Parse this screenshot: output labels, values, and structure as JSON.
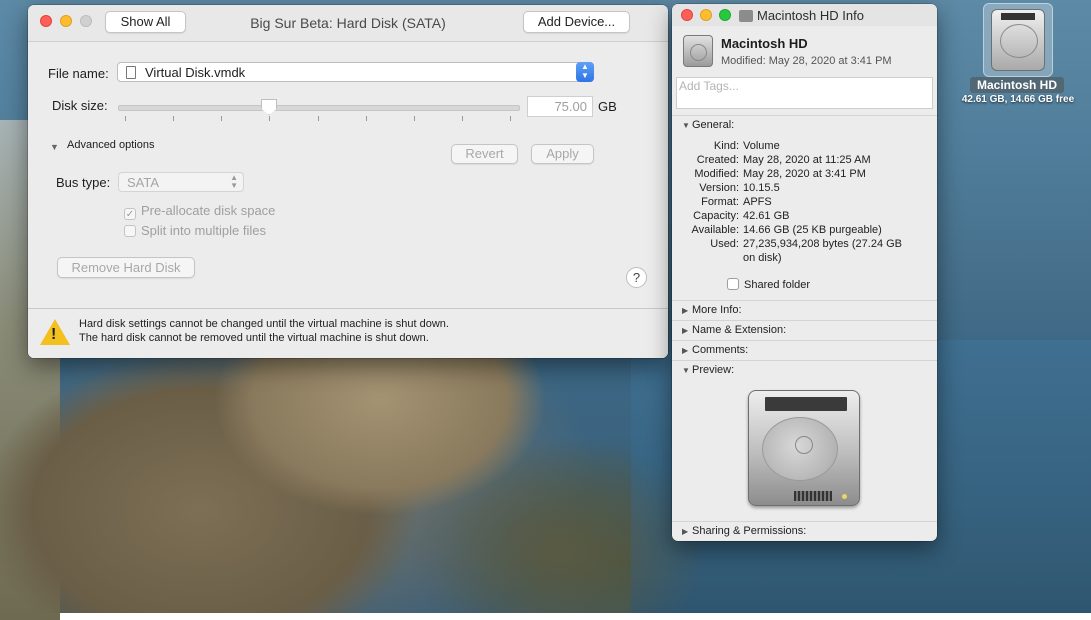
{
  "vm_window": {
    "title": "Big Sur Beta: Hard Disk (SATA)",
    "show_all": "Show All",
    "add_device": "Add Device...",
    "file_name_label": "File name:",
    "file_name": "Virtual Disk.vmdk",
    "disk_size_label": "Disk size:",
    "disk_size_value": "75.00",
    "disk_size_unit": "GB",
    "advanced_options": "Advanced options",
    "revert": "Revert",
    "apply": "Apply",
    "bus_type_label": "Bus type:",
    "bus_type_value": "SATA",
    "preallocate": "Pre-allocate disk space",
    "preallocate_checked": true,
    "split_files": "Split into multiple files",
    "remove_hard_disk": "Remove Hard Disk",
    "help": "?",
    "warning_line1": "Hard disk settings cannot be changed until the virtual machine is shut down.",
    "warning_line2": "The hard disk cannot be removed until the virtual machine is shut down."
  },
  "info_window": {
    "title": "Macintosh HD Info",
    "name": "Macintosh HD",
    "modified_header": "Modified: May 28, 2020 at 3:41 PM",
    "tags_placeholder": "Add Tags...",
    "general_label": "General:",
    "general": [
      {
        "key": "Kind:",
        "value": "Volume"
      },
      {
        "key": "Created:",
        "value": "May 28, 2020 at 11:25 AM"
      },
      {
        "key": "Modified:",
        "value": "May 28, 2020 at 3:41 PM"
      },
      {
        "key": "Version:",
        "value": "10.15.5"
      },
      {
        "key": "Format:",
        "value": "APFS"
      },
      {
        "key": "Capacity:",
        "value": "42.61 GB"
      },
      {
        "key": "Available:",
        "value": "14.66 GB (25 KB purgeable)"
      },
      {
        "key": "Used:",
        "value": "27,235,934,208 bytes (27.24 GB"
      },
      {
        "key": "",
        "value": "on disk)"
      }
    ],
    "shared_folder": "Shared folder",
    "more_info": "More Info:",
    "name_extension": "Name & Extension:",
    "comments": "Comments:",
    "preview": "Preview:",
    "sharing_permissions": "Sharing & Permissions:"
  },
  "desktop": {
    "icon_name": "Macintosh HD",
    "icon_sub": "42.61 GB, 14.66 GB free"
  }
}
